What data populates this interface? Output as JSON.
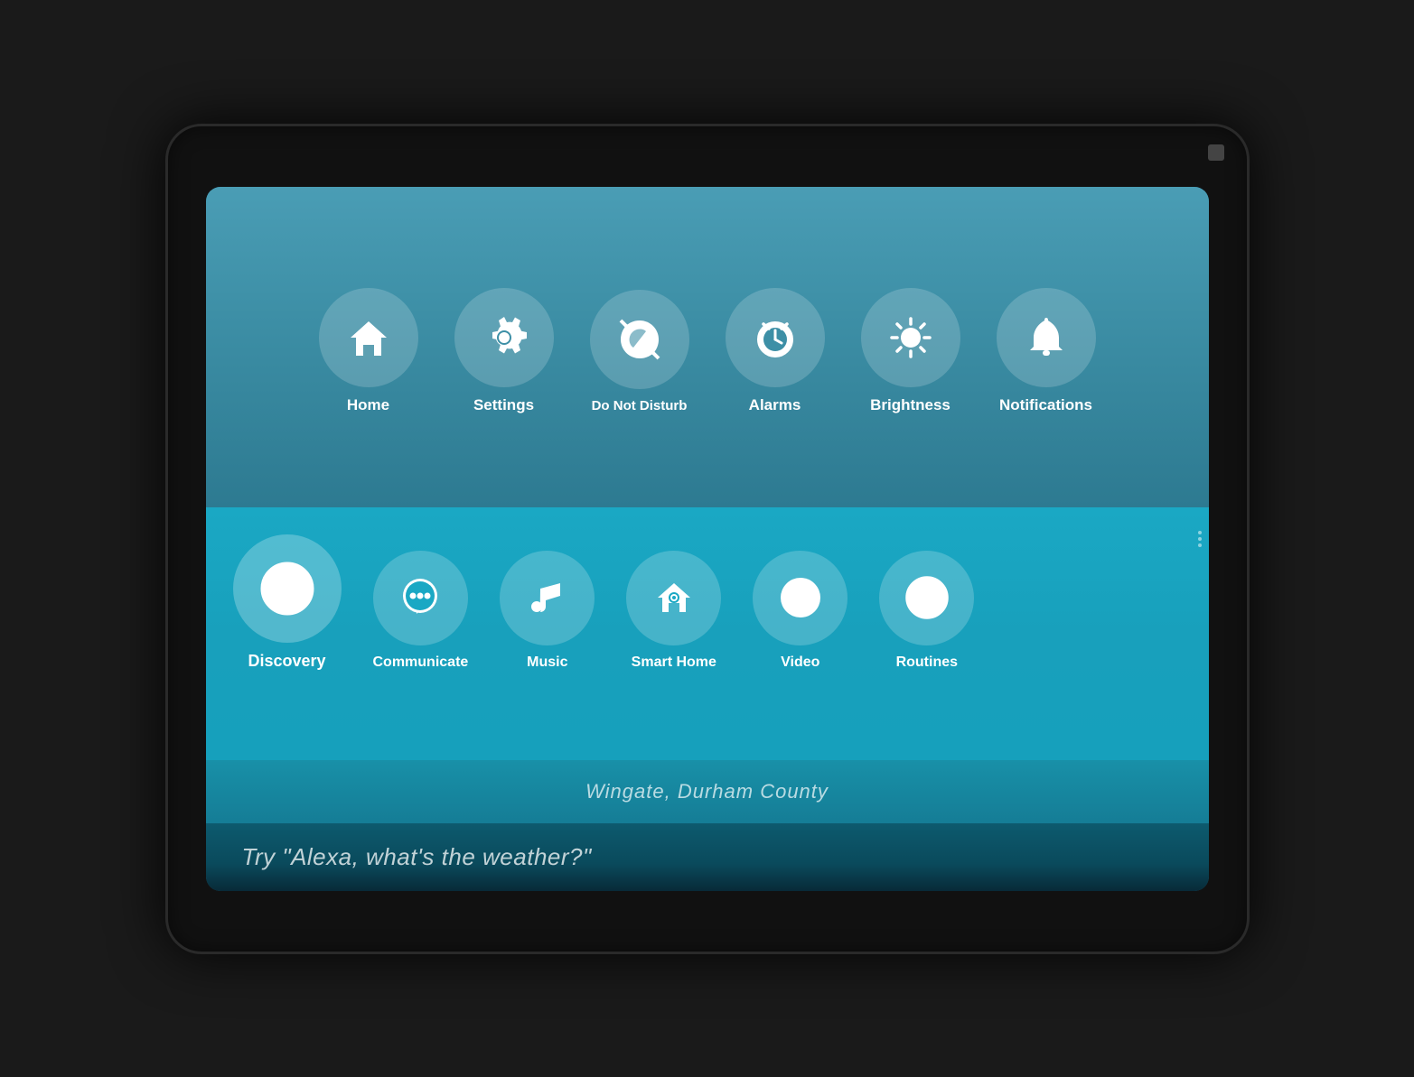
{
  "device": {
    "camera_label": "camera"
  },
  "top_row": {
    "items": [
      {
        "id": "home",
        "label": "Home",
        "icon": "home"
      },
      {
        "id": "settings",
        "label": "Settings",
        "icon": "settings"
      },
      {
        "id": "do-not-disturb",
        "label": "Do Not Disturb",
        "icon": "dnd"
      },
      {
        "id": "alarms",
        "label": "Alarms",
        "icon": "alarm"
      },
      {
        "id": "brightness",
        "label": "Brightness",
        "icon": "brightness"
      },
      {
        "id": "notifications",
        "label": "Notifications",
        "icon": "bell"
      }
    ]
  },
  "bottom_row": {
    "items": [
      {
        "id": "discovery",
        "label": "Discovery",
        "icon": "compass",
        "featured": true
      },
      {
        "id": "communicate",
        "label": "Communicate",
        "icon": "chat"
      },
      {
        "id": "music",
        "label": "Music",
        "icon": "music"
      },
      {
        "id": "smart-home",
        "label": "Smart Home",
        "icon": "smarthome"
      },
      {
        "id": "video",
        "label": "Video",
        "icon": "play"
      },
      {
        "id": "routines",
        "label": "Routines",
        "icon": "routines"
      }
    ]
  },
  "location": {
    "text": "Wingate, Durham County"
  },
  "hint": {
    "text": "Try \"Alexa, what's the weather?\""
  }
}
